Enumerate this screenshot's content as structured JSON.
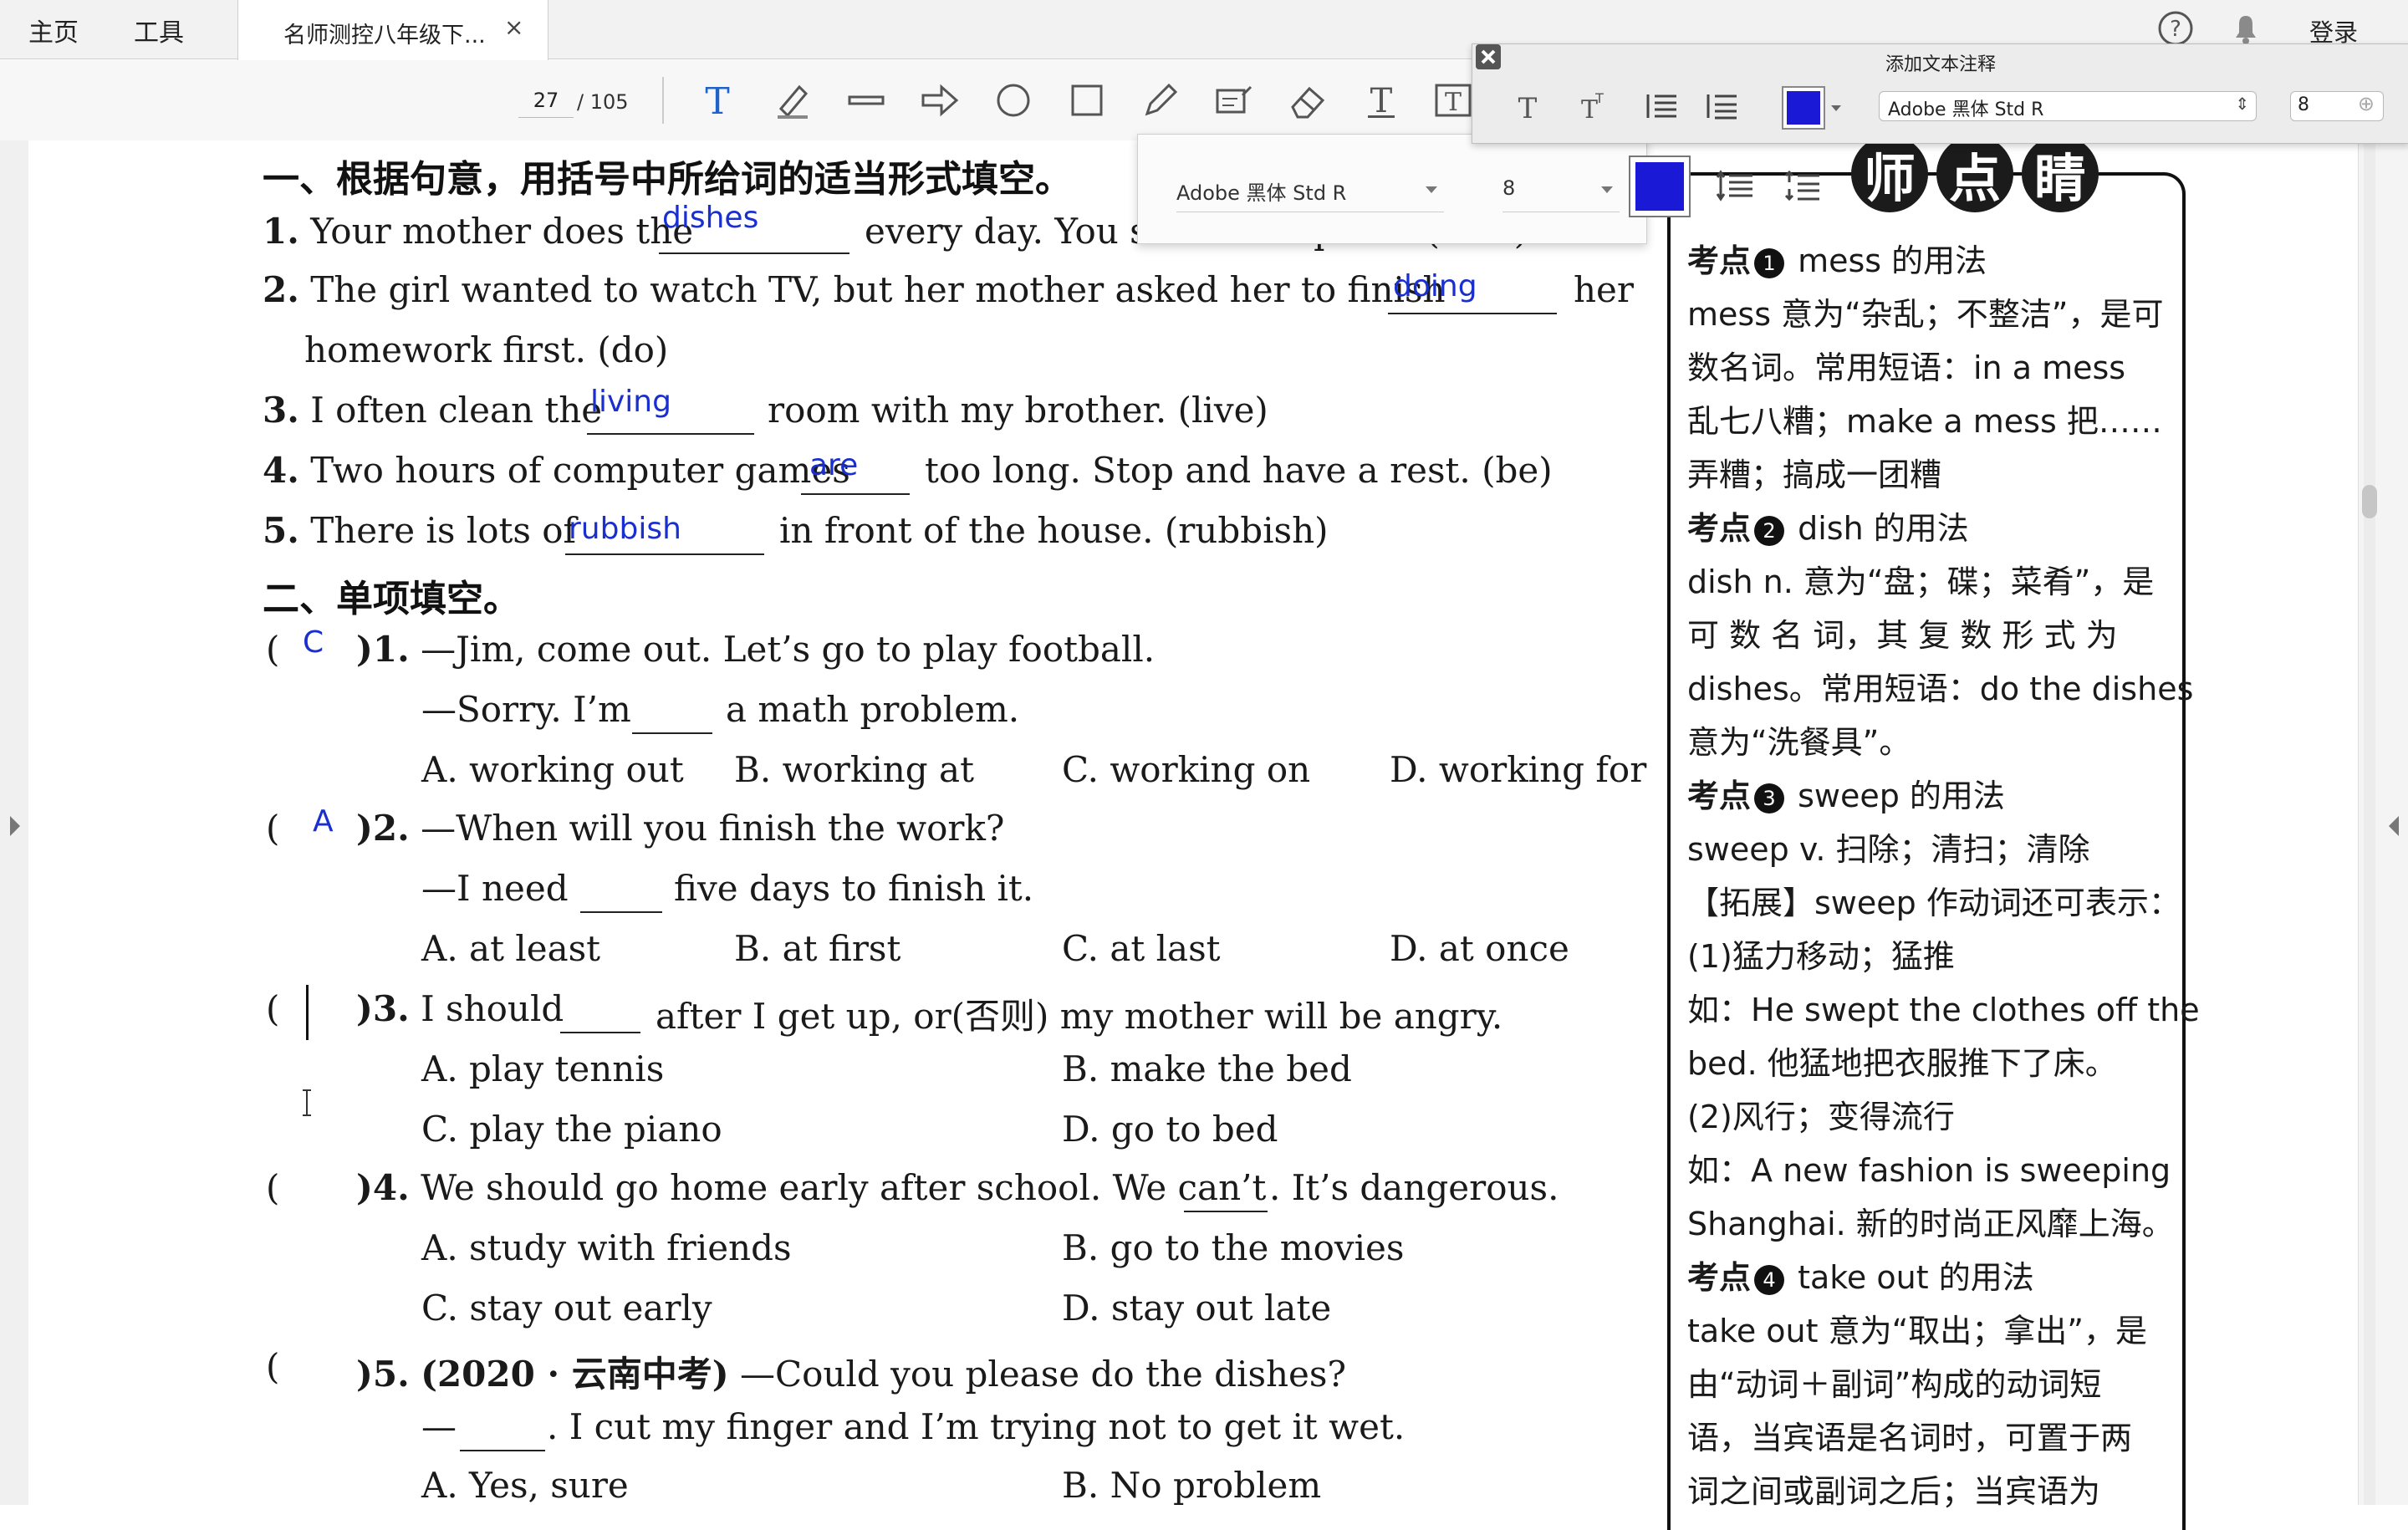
{
  "tabs": {
    "home": "主页",
    "tools": "工具",
    "document": "名师测控八年级下...",
    "close": "×"
  },
  "header_right": {
    "login": "登录"
  },
  "toolbar": {
    "page_current": "27",
    "page_total": "/ 105"
  },
  "annotation_panel": {
    "title": "添加文本注释",
    "font": "Adobe 黑体 Std R",
    "size": "8",
    "color": "#1a1ad6"
  },
  "text_popup": {
    "font": "Adobe 黑体 Std R",
    "size": "8",
    "color": "#1a1ad6"
  },
  "section1": {
    "title": "一、根据句意，用括号中所给词的适当形式填空。",
    "q1": {
      "num": "1.",
      "pre": "Your mother does the",
      "post": "every day. You should help her. (dish)",
      "answer": "dishes"
    },
    "q2": {
      "num": "2.",
      "pre": "The girl wanted to watch TV, but her mother asked her to finish",
      "post": "her",
      "line2": "homework first. (do)",
      "answer": "doing"
    },
    "q3": {
      "num": "3.",
      "pre": "I often clean the",
      "post": "room with my brother. (live)",
      "answer": "living"
    },
    "q4": {
      "num": "4.",
      "pre": "Two hours of computer games",
      "post": "too long. Stop and have a rest. (be)",
      "answer": "are"
    },
    "q5": {
      "num": "5.",
      "pre": "There is lots of",
      "post": "in front of the house. (rubbish)",
      "answer": "rubbish"
    }
  },
  "section2": {
    "title": "二、单项填空。",
    "q1": {
      "answer": "C",
      "num": ")1.",
      "line1": "—Jim, come out. Let’s go to play football.",
      "line2a": "—Sorry. I’m",
      "line2b": "a math problem.",
      "A": "A. working out",
      "B": "B. working at",
      "C": "C. working on",
      "D": "D. working for"
    },
    "q2": {
      "answer": "A",
      "num": ")2.",
      "line1": "—When will you finish the work?",
      "line2a": "—I need",
      "line2b": "five days to finish it.",
      "A": "A. at least",
      "B": "B. at first",
      "C": "C. at last",
      "D": "D. at once"
    },
    "q3": {
      "num": ")3.",
      "pre": "I should",
      "post": "after I get up, or(否则) my mother will be angry.",
      "A": "A. play tennis",
      "B": "B. make the bed",
      "C": "C. play the piano",
      "D": "D. go to bed"
    },
    "q4": {
      "num": ")4.",
      "pre": "We should go home early after school. We can’t",
      "post": ". It’s dangerous.",
      "A": "A. study with friends",
      "B": "B. go to the movies",
      "C": "C. stay out early",
      "D": "D. stay out late"
    },
    "q5": {
      "num": ")5.",
      "tag": "(2020 · 云南中考)",
      "line1": "—Could you please do the dishes?",
      "line2a": "—",
      "line2b": ". I cut my finger and I’m trying not to get it wet.",
      "A": "A. Yes, sure",
      "B": "B. No problem"
    },
    "paren": "("
  },
  "sidebar": {
    "heading": "师点睛",
    "lines": [
      {
        "kd": "考点",
        "num": "1",
        "text": "mess 的用法"
      },
      {
        "text": "mess 意为“杂乱；不整洁”，是可"
      },
      {
        "text": "数名词。常用短语：in a mess"
      },
      {
        "text": "乱七八糟；make a mess 把……"
      },
      {
        "text": "弄糟；搞成一团糟"
      },
      {
        "kd": "考点",
        "num": "2",
        "text": "dish 的用法"
      },
      {
        "text": "dish n. 意为“盘；碟；菜肴”，是"
      },
      {
        "text": "可 数 名 词，其 复 数 形 式 为"
      },
      {
        "text": "dishes。常用短语：do the dishes"
      },
      {
        "text": "意为“洗餐具”。"
      },
      {
        "kd": "考点",
        "num": "3",
        "text": "sweep 的用法"
      },
      {
        "text": "sweep v. 扫除；清扫；清除"
      },
      {
        "text": "【拓展】sweep 作动词还可表示："
      },
      {
        "text": "(1)猛力移动；猛推"
      },
      {
        "text": "如：He swept the clothes off the"
      },
      {
        "text": "bed. 他猛地把衣服推下了床。"
      },
      {
        "text": "(2)风行；变得流行"
      },
      {
        "text": "如：A new fashion is sweeping"
      },
      {
        "text": "Shanghai. 新的时尚正风靡上海。"
      },
      {
        "kd": "考点",
        "num": "4",
        "text": "take out 的用法"
      },
      {
        "text": "take out 意为“取出；拿出”，是"
      },
      {
        "text": "由“动词＋副词”构成的动词短"
      },
      {
        "text": "语，当宾语是名词时，可置于两"
      },
      {
        "text": "词之间或副词之后；当宾语为"
      }
    ]
  }
}
